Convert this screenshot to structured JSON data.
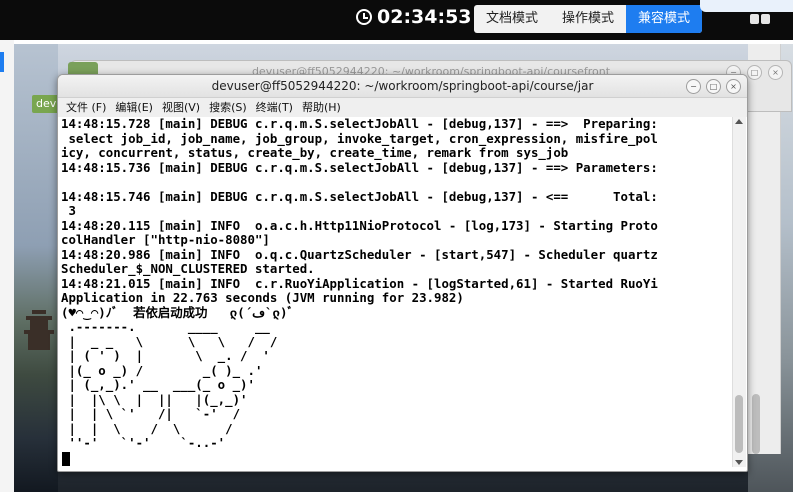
{
  "topbar": {
    "timer": "02:34:53",
    "modes": [
      {
        "label": "文档模式",
        "active": false
      },
      {
        "label": "操作模式",
        "active": false
      },
      {
        "label": "兼容模式",
        "active": true
      }
    ]
  },
  "desktop": {
    "tag_label": "dev"
  },
  "background_window": {
    "title": "devuser@ff5052944220: ~/workroom/springboot-api/coursefront"
  },
  "terminal": {
    "title": "devuser@ff5052944220: ~/workroom/springboot-api/course/jar",
    "menu": [
      "文件 (F)",
      "编辑(E)",
      "视图(V)",
      "搜索(S)",
      "终端(T)",
      "帮助(H)"
    ],
    "window_buttons": [
      "−",
      "□",
      "×"
    ],
    "lines": [
      "14:48:15.728 [main] DEBUG c.r.q.m.S.selectJobAll - [debug,137] - ==>  Preparing:",
      " select job_id, job_name, job_group, invoke_target, cron_expression, misfire_pol",
      "icy, concurrent, status, create_by, create_time, remark from sys_job",
      "14:48:15.736 [main] DEBUG c.r.q.m.S.selectJobAll - [debug,137] - ==> Parameters:",
      "",
      "14:48:15.746 [main] DEBUG c.r.q.m.S.selectJobAll - [debug,137] - <==      Total:",
      " 3",
      "14:48:20.115 [main] INFO  o.a.c.h.Http11NioProtocol - [log,173] - Starting Proto",
      "colHandler [\"http-nio-8080\"]",
      "14:48:20.986 [main] INFO  o.q.c.QuartzScheduler - [start,547] - Scheduler quartz",
      "Scheduler_$_NON_CLUSTERED started.",
      "14:48:21.015 [main] INFO  c.r.RuoYiApplication - [logStarted,61] - Started RuoYi",
      "Application in 22.763 seconds (JVM running for 23.982)",
      "(♥◠‿◠)ﾉﾞ  若依启动成功   ლ(´ڡ`ლ)ﾞ",
      " .-------.       ____     __",
      " |  _ _   \\      \\   \\   /  /",
      " | ( ' )  |       \\  _. /  '",
      " |(_ o _) /        _( )_ .'",
      " | (_,_).' __  ___(_ o _)'",
      " |  |\\ \\  |  ||   |(_,_)'",
      " |  | \\ `'   /|   `-'  /",
      " |  |  \\    /  \\      /",
      " ''-'   `'-'    `-..-'"
    ]
  }
}
